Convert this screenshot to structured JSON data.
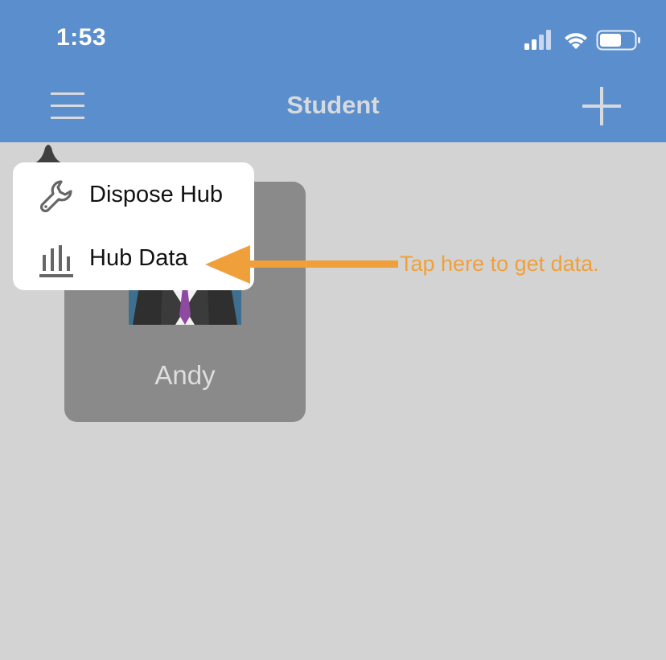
{
  "status_bar": {
    "time": "1:53",
    "icons": [
      "signal-icon",
      "wifi-icon",
      "battery-icon"
    ]
  },
  "nav_bar": {
    "title": "Student",
    "left_icon": "hamburger-menu-icon",
    "right_icon": "plus-icon"
  },
  "popover_menu": {
    "items": [
      {
        "label": "Dispose Hub",
        "icon": "wrench-icon"
      },
      {
        "label": "Hub Data",
        "icon": "bar-chart-icon"
      }
    ]
  },
  "students": [
    {
      "name": "Andy",
      "avatar": "businessman-avatar"
    }
  ],
  "annotation": {
    "text": "Tap here to get data."
  },
  "colors": {
    "header_bg": "#5b8ecc",
    "page_bg": "#d3d3d3",
    "card_bg": "#8a8a8a",
    "annotation": "#f0a03a"
  }
}
